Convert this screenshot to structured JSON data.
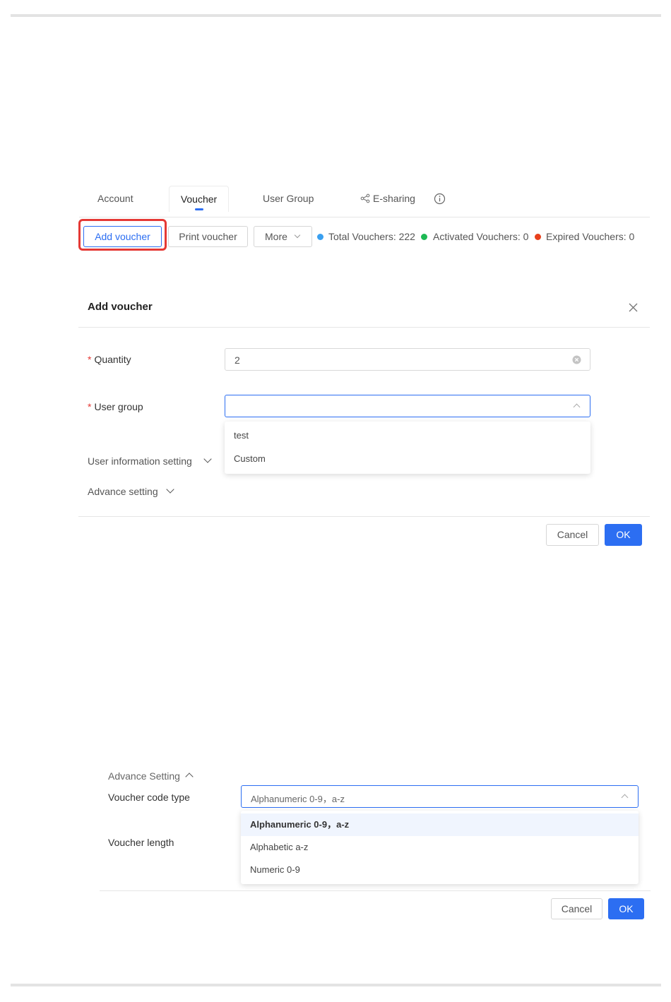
{
  "tabs": {
    "account": "Account",
    "voucher": "Voucher",
    "user_group": "User Group",
    "esharing": "E-sharing"
  },
  "toolbar": {
    "add_voucher": "Add voucher",
    "print_voucher": "Print voucher",
    "more": "More"
  },
  "stats": {
    "total": "Total Vouchers: 222",
    "activated": "Activated Vouchers: 0",
    "expired": "Expired Vouchers: 0",
    "colors": {
      "total": "#3aa0f0",
      "activated": "#1db954",
      "expired": "#e8401c"
    }
  },
  "dialog": {
    "title": "Add voucher",
    "quantity_label": "Quantity",
    "quantity_value": "2",
    "user_group_label": "User group",
    "user_group_value": "",
    "user_group_options": [
      "test",
      "Custom"
    ],
    "user_info_setting": "User information setting",
    "advance_setting": "Advance setting",
    "cancel": "Cancel",
    "ok": "OK"
  },
  "advanced": {
    "section_title": "Advance Setting",
    "code_type_label": "Voucher code type",
    "code_type_value": "Alphanumeric 0-9，a-z",
    "code_type_options": [
      "Alphanumeric 0-9，a-z",
      "Alphabetic a-z",
      "Numeric 0-9"
    ],
    "length_label": "Voucher length",
    "cancel": "Cancel",
    "ok": "OK"
  },
  "accent_color": "#2c6ef2",
  "highlight_color": "#e53935"
}
